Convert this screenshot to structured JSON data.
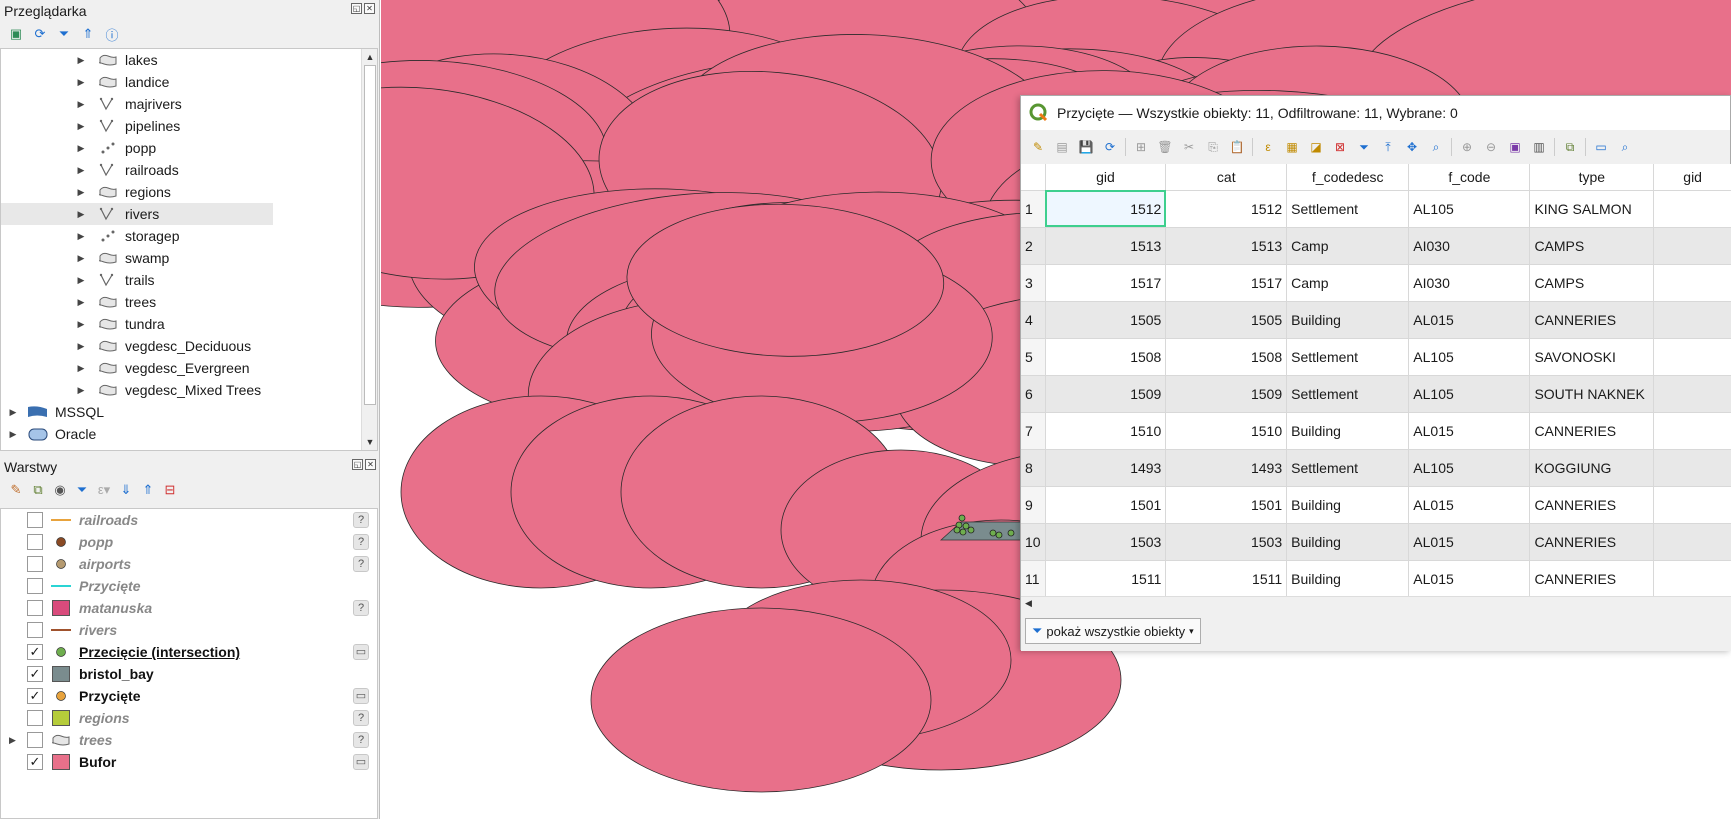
{
  "browser": {
    "title": "Przeglądarka",
    "items": [
      {
        "label": "lakes",
        "icon": "polygon-layer-icon"
      },
      {
        "label": "landice",
        "icon": "polygon-layer-icon"
      },
      {
        "label": "majrivers",
        "icon": "line-layer-icon"
      },
      {
        "label": "pipelines",
        "icon": "line-layer-icon"
      },
      {
        "label": "popp",
        "icon": "point-layer-icon"
      },
      {
        "label": "railroads",
        "icon": "line-layer-icon"
      },
      {
        "label": "regions",
        "icon": "polygon-layer-icon"
      },
      {
        "label": "rivers",
        "icon": "line-layer-icon",
        "selected": true
      },
      {
        "label": "storagep",
        "icon": "point-layer-icon"
      },
      {
        "label": "swamp",
        "icon": "polygon-layer-icon"
      },
      {
        "label": "trails",
        "icon": "line-layer-icon"
      },
      {
        "label": "trees",
        "icon": "polygon-layer-icon"
      },
      {
        "label": "tundra",
        "icon": "polygon-layer-icon"
      },
      {
        "label": "vegdesc_Deciduous",
        "icon": "polygon-layer-icon"
      },
      {
        "label": "vegdesc_Evergreen",
        "icon": "polygon-layer-icon"
      },
      {
        "label": "vegdesc_Mixed Trees",
        "icon": "polygon-layer-icon"
      }
    ],
    "providers": [
      {
        "label": "MSSQL",
        "icon": "mssql-icon"
      },
      {
        "label": "Oracle",
        "icon": "oracle-icon"
      }
    ]
  },
  "layers": {
    "title": "Warstwy",
    "items": [
      {
        "label": "railroads",
        "checked": false,
        "symbol": "line",
        "color": "#e8a33d",
        "status": "?"
      },
      {
        "label": "popp",
        "checked": false,
        "symbol": "point",
        "color": "#8a4a24",
        "status": "?"
      },
      {
        "label": "airports",
        "checked": false,
        "symbol": "point",
        "color": "#b59a70",
        "status": "?"
      },
      {
        "label": "Przycięte",
        "checked": false,
        "symbol": "line",
        "color": "#2ad4d4",
        "status": ""
      },
      {
        "label": "matanuska",
        "checked": false,
        "symbol": "fill",
        "color": "#d94b7c",
        "status": "?"
      },
      {
        "label": "rivers",
        "checked": false,
        "symbol": "line",
        "color": "#a0522d",
        "status": ""
      },
      {
        "label": "Przecięcie (intersection)",
        "checked": true,
        "symbol": "point",
        "color": "#6fae4e",
        "status": "mem",
        "underline": true
      },
      {
        "label": "bristol_bay",
        "checked": true,
        "symbol": "fill",
        "color": "#7a8c8e",
        "status": ""
      },
      {
        "label": "Przycięte",
        "checked": true,
        "symbol": "point",
        "color": "#e8a33d",
        "status": "mem"
      },
      {
        "label": "regions",
        "checked": false,
        "symbol": "fill",
        "color": "#b5cc3a",
        "status": "?"
      },
      {
        "label": "trees",
        "checked": false,
        "symbol": "group",
        "color": "#999999",
        "status": "?",
        "expandable": true
      },
      {
        "label": "Bufor",
        "checked": true,
        "symbol": "fill",
        "color": "#e8708a",
        "status": "mem"
      }
    ]
  },
  "attribute_table": {
    "title": "Przycięte — Wszystkie obiekty: 11, Odfiltrowane: 11, Wybrane: 0",
    "columns": [
      "gid",
      "cat",
      "f_codedesc",
      "f_code",
      "type",
      "gid"
    ],
    "rows": [
      {
        "n": "1",
        "gid": "1512",
        "cat": "1512",
        "f_codedesc": "Settlement",
        "f_code": "AL105",
        "type": "KING SALMON"
      },
      {
        "n": "2",
        "gid": "1513",
        "cat": "1513",
        "f_codedesc": "Camp",
        "f_code": "AI030",
        "type": "CAMPS"
      },
      {
        "n": "3",
        "gid": "1517",
        "cat": "1517",
        "f_codedesc": "Camp",
        "f_code": "AI030",
        "type": "CAMPS"
      },
      {
        "n": "4",
        "gid": "1505",
        "cat": "1505",
        "f_codedesc": "Building",
        "f_code": "AL015",
        "type": "CANNERIES"
      },
      {
        "n": "5",
        "gid": "1508",
        "cat": "1508",
        "f_codedesc": "Settlement",
        "f_code": "AL105",
        "type": "SAVONOSKI"
      },
      {
        "n": "6",
        "gid": "1509",
        "cat": "1509",
        "f_codedesc": "Settlement",
        "f_code": "AL105",
        "type": "SOUTH NAKNEK"
      },
      {
        "n": "7",
        "gid": "1510",
        "cat": "1510",
        "f_codedesc": "Building",
        "f_code": "AL015",
        "type": "CANNERIES"
      },
      {
        "n": "8",
        "gid": "1493",
        "cat": "1493",
        "f_codedesc": "Settlement",
        "f_code": "AL105",
        "type": "KOGGIUNG"
      },
      {
        "n": "9",
        "gid": "1501",
        "cat": "1501",
        "f_codedesc": "Building",
        "f_code": "AL015",
        "type": "CANNERIES"
      },
      {
        "n": "10",
        "gid": "1503",
        "cat": "1503",
        "f_codedesc": "Building",
        "f_code": "AL015",
        "type": "CANNERIES"
      },
      {
        "n": "11",
        "gid": "1511",
        "cat": "1511",
        "f_codedesc": "Building",
        "f_code": "AL015",
        "type": "CANNERIES"
      }
    ],
    "filter_button": "pokaż wszystkie obiekty"
  },
  "colors": {
    "buffer_fill": "#e8708a",
    "buffer_stroke": "#2a2a2a",
    "bristol_bay": "#7a8c8e",
    "intersection_points": "#6fae4e",
    "focus": "#3ecf8e"
  }
}
